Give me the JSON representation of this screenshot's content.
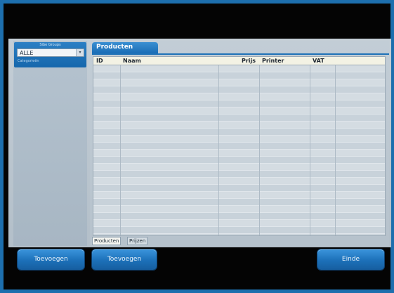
{
  "group": {
    "header": "Sibe Groups",
    "selected": "ALLE",
    "category_label": "Categorieën"
  },
  "products_tab": {
    "label": "Producten"
  },
  "table": {
    "columns": [
      "ID",
      "Naam",
      "Prijs",
      "Printer",
      "VAT"
    ],
    "row_count": 24
  },
  "bottom_tabs": [
    "Producten",
    "Prijzen"
  ],
  "buttons": {
    "add_left": "Toevoegen",
    "add_mid": "Toevoegen",
    "end": "Einde"
  }
}
